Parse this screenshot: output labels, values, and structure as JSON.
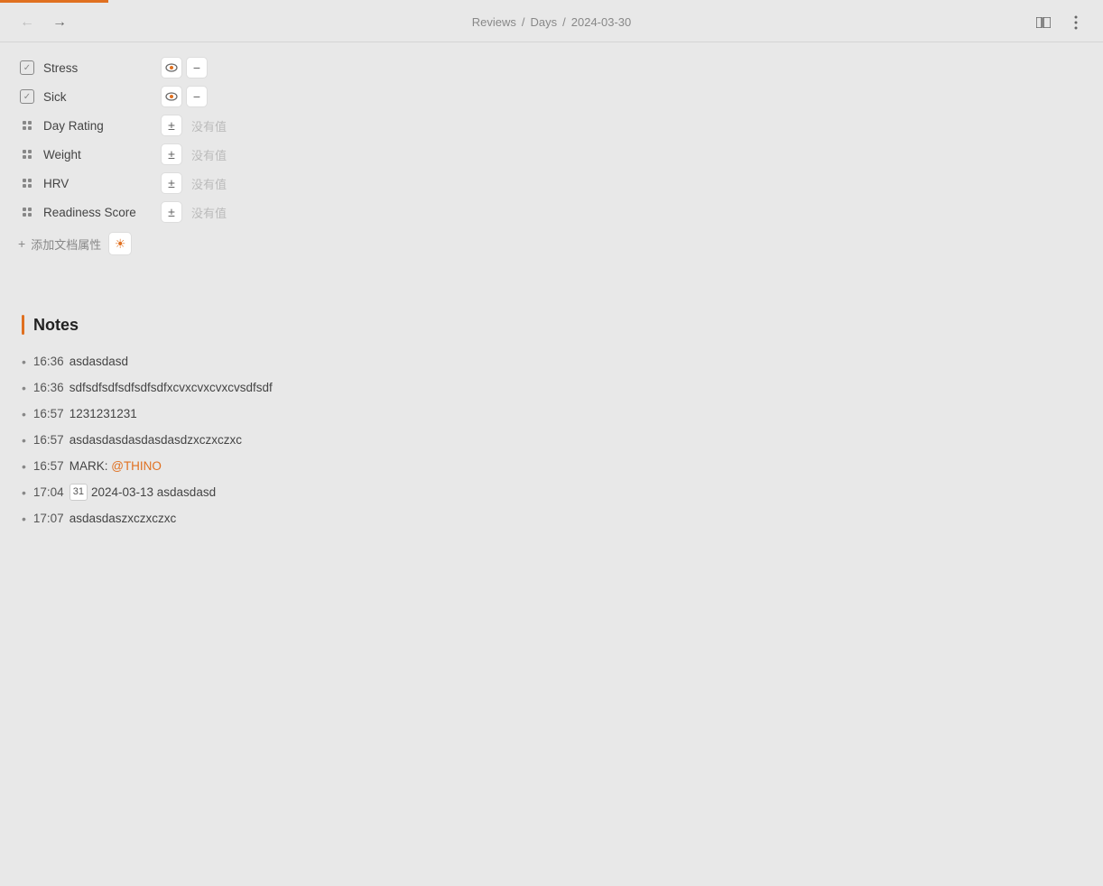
{
  "nav": {
    "back_disabled": true,
    "forward_disabled": false,
    "breadcrumb": [
      "Reviews",
      "Days",
      "2024-03-30"
    ],
    "breadcrumb_separator": "/"
  },
  "top_stripe": {},
  "properties": [
    {
      "id": "stress",
      "icon_type": "checkbox",
      "name": "Stress",
      "has_eye": true,
      "has_minus": true,
      "has_plus": false,
      "no_value": false
    },
    {
      "id": "sick",
      "icon_type": "checkbox",
      "name": "Sick",
      "has_eye": true,
      "has_minus": true,
      "has_plus": false,
      "no_value": false
    },
    {
      "id": "day_rating",
      "icon_type": "grid",
      "name": "Day Rating",
      "has_eye": false,
      "has_minus": false,
      "has_plus": true,
      "no_value": true,
      "no_value_text": "没有值"
    },
    {
      "id": "weight",
      "icon_type": "grid",
      "name": "Weight",
      "has_eye": false,
      "has_minus": false,
      "has_plus": true,
      "no_value": true,
      "no_value_text": "没有值"
    },
    {
      "id": "hrv",
      "icon_type": "grid",
      "name": "HRV",
      "has_eye": false,
      "has_minus": false,
      "has_plus": true,
      "no_value": true,
      "no_value_text": "没有值"
    },
    {
      "id": "readiness_score",
      "icon_type": "grid",
      "name": "Readiness Score",
      "has_eye": false,
      "has_minus": false,
      "has_plus": true,
      "no_value": true,
      "no_value_text": "没有值"
    }
  ],
  "add_property": {
    "label": "添加文档属性"
  },
  "notes": {
    "title": "Notes",
    "items": [
      {
        "time": "16:36",
        "text": "asdasdasd",
        "has_link": false,
        "has_date_badge": false
      },
      {
        "time": "16:36",
        "text": "sdfsdfsdfsdfsdfsdfxcvxcvxcvxcvsdfsdf",
        "has_link": false,
        "has_date_badge": false
      },
      {
        "time": "16:57",
        "text": "1231231231",
        "has_link": false,
        "has_date_badge": false
      },
      {
        "time": "16:57",
        "text": "asdasdasdasdasdasdzxczxczxc",
        "has_link": false,
        "has_date_badge": false
      },
      {
        "time": "16:57",
        "prefix": "MARK:",
        "link_text": "@THINO",
        "has_link": true,
        "has_date_badge": false
      },
      {
        "time": "17:04",
        "date_badge": "31",
        "date_badge_full": "2024-03-13",
        "text": "asdasdasd",
        "has_link": false,
        "has_date_badge": true
      },
      {
        "time": "17:07",
        "text": "asdasdaszxczxczxc",
        "has_link": false,
        "has_date_badge": false
      }
    ]
  }
}
